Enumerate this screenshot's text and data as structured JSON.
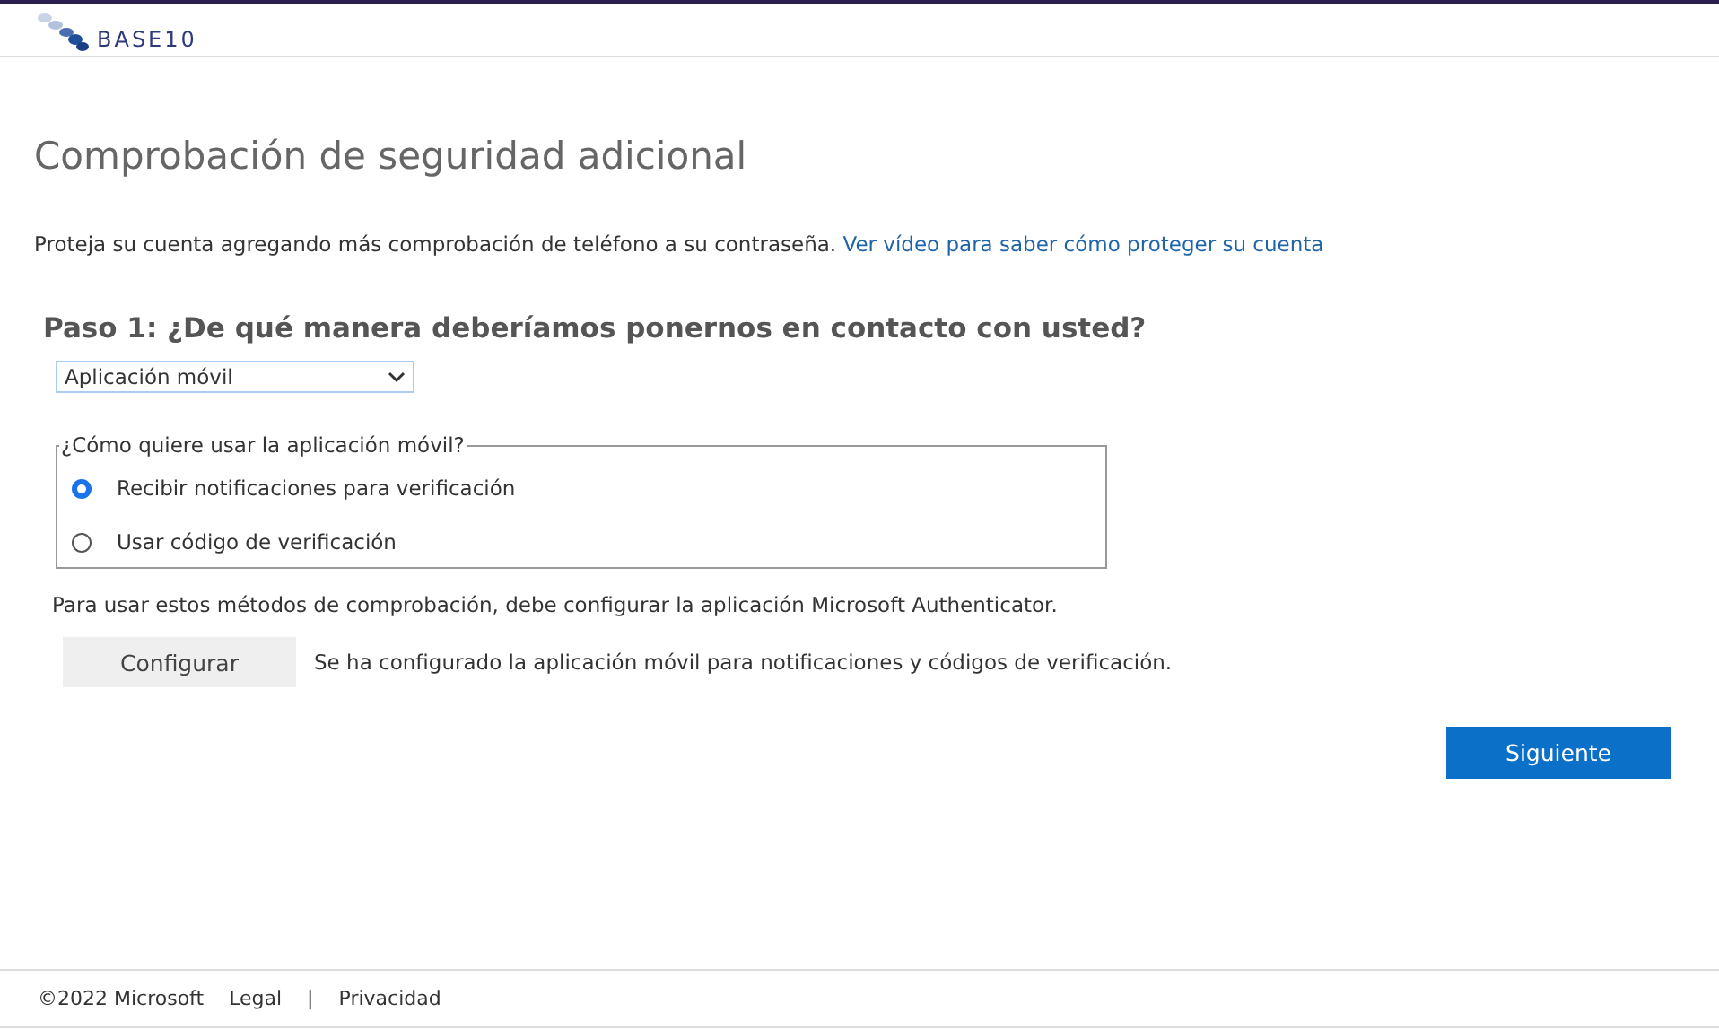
{
  "header": {
    "logo_text": "BASE10"
  },
  "title": "Comprobación de seguridad adicional",
  "intro": {
    "text": "Proteja su cuenta agregando más comprobación de teléfono a su contraseña.",
    "link": "Ver vídeo para saber cómo proteger su cuenta"
  },
  "step": {
    "heading": "Paso 1: ¿De qué manera deberíamos ponernos en contacto con usted?",
    "method": "Aplicación móvil"
  },
  "usage": {
    "legend": "¿Cómo quiere usar la aplicación móvil?",
    "options": [
      {
        "label": "Recibir notificaciones para verificación",
        "selected": true
      },
      {
        "label": "Usar código de verificación",
        "selected": false
      }
    ]
  },
  "note": "Para usar estos métodos de comprobación, debe configurar la aplicación Microsoft Authenticator.",
  "configure": {
    "button": "Configurar",
    "status": "Se ha configurado la aplicación móvil para notificaciones y códigos de verificación."
  },
  "next_button": "Siguiente",
  "footer": {
    "copyright": "©2022 Microsoft",
    "links": [
      "Legal",
      "Privacidad"
    ],
    "separator": "|"
  }
}
